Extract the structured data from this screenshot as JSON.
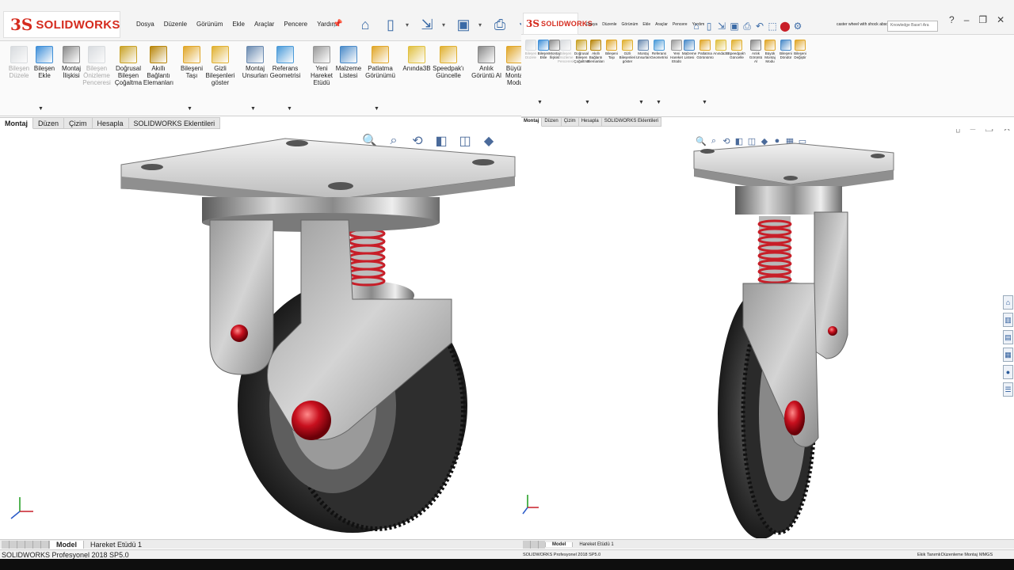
{
  "app": {
    "logo_mark": "3S",
    "logo_text": "SOLIDWORKS"
  },
  "menu": [
    "Dosya",
    "Düzenle",
    "Görünüm",
    "Ekle",
    "Araçlar",
    "Pencere",
    "Yardım"
  ],
  "ribbon": {
    "tools": [
      {
        "label": "Bileşen Düzele",
        "disabled": true,
        "color": "#9aa3ad"
      },
      {
        "label": "Bileşen Ekle",
        "disabled": false,
        "color": "#3f8fd8"
      },
      {
        "label": "Montaj İlişkisi",
        "disabled": false,
        "color": "#8a8a8a"
      },
      {
        "label": "Bileşen Önizleme Penceresi",
        "disabled": true,
        "color": "#9aa3ad"
      },
      {
        "label": "Doğrusal Bileşen Çoğaltma",
        "disabled": false,
        "color": "#c9a227"
      },
      {
        "label": "Akıllı Bağlantı Elemanları",
        "disabled": false,
        "color": "#b8860b"
      },
      {
        "label": "Bileşeni Taşı",
        "disabled": false,
        "color": "#e0a628"
      },
      {
        "label": "Gizli Bileşenleri göster",
        "disabled": false,
        "color": "#e0b030"
      },
      {
        "label": "Montaj Unsurları",
        "disabled": false,
        "color": "#6a8ab0"
      },
      {
        "label": "Referans Geometrisi",
        "disabled": false,
        "color": "#4a9ad8"
      },
      {
        "label": "Yeni Hareket Etüdü",
        "disabled": false,
        "color": "#999999"
      },
      {
        "label": "Malzeme Listesi",
        "disabled": false,
        "color": "#4a8ac8"
      },
      {
        "label": "Patlatma Görünümü",
        "disabled": false,
        "color": "#e0a628"
      },
      {
        "label": "Anında3B",
        "disabled": false,
        "color": "#e0c040"
      },
      {
        "label": "Speedpak'ı Güncelle",
        "disabled": false,
        "color": "#e0b030"
      },
      {
        "label": "Anlık Görüntü Al",
        "disabled": false,
        "color": "#888888"
      },
      {
        "label": "Büyük Montaj Modu",
        "disabled": false,
        "color": "#e0a628"
      }
    ],
    "right_extra_tools": [
      {
        "label": "Bileşeni Döndür",
        "color": "#4a8ac8"
      },
      {
        "label": "Bileşeni Değiştir",
        "color": "#e0a628"
      }
    ]
  },
  "command_tabs": [
    "Montaj",
    "Düzen",
    "Çizim",
    "Hesapla",
    "SOLIDWORKS Eklentileri"
  ],
  "model_tabs": [
    "Model",
    "Hareket Etüdü 1"
  ],
  "status": {
    "left": "SOLIDWORKS Profesyonel 2018 SP5.0",
    "right_items": [
      "Ekik Tanımlı",
      "Düzenleme Montaj",
      "MMGS"
    ]
  },
  "document": {
    "title": "caster wheel with shock absorber *",
    "search_placeholder": "Knowledge Base'i Ara"
  },
  "colors": {
    "brand": "#d52b1e",
    "spring": "#c81e28",
    "hub": "#c8101e"
  }
}
